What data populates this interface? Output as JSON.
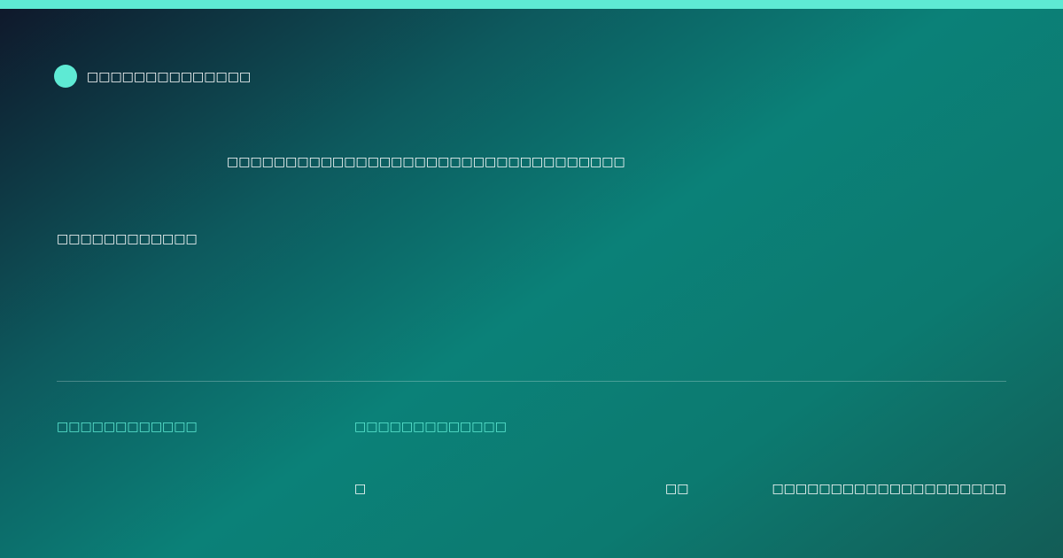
{
  "theme": {
    "accent": "#5eead4",
    "gradient_start": "#0f172a",
    "gradient_mid": "#0b8178",
    "gradient_end": "#135c56",
    "text": "#ffffff",
    "divider": "rgba(255,255,255,0.25)"
  },
  "brand": {
    "logo_icon": "circle-icon",
    "name": "□□□□□□□□□□□□□□"
  },
  "hero": {
    "headline": "□□□□□□□□□□□□□□□□□□□□□□□□□□□□□□□□□□",
    "subtitle": "□□□□□□□□□□□□"
  },
  "footer": {
    "left_label": "□□□□□□□□□□□□",
    "middle_label": "□□□□□□□□□□□□□",
    "values": [
      "□",
      "□□",
      "□□□□□□□□□□□□□□□□□□□□"
    ]
  }
}
